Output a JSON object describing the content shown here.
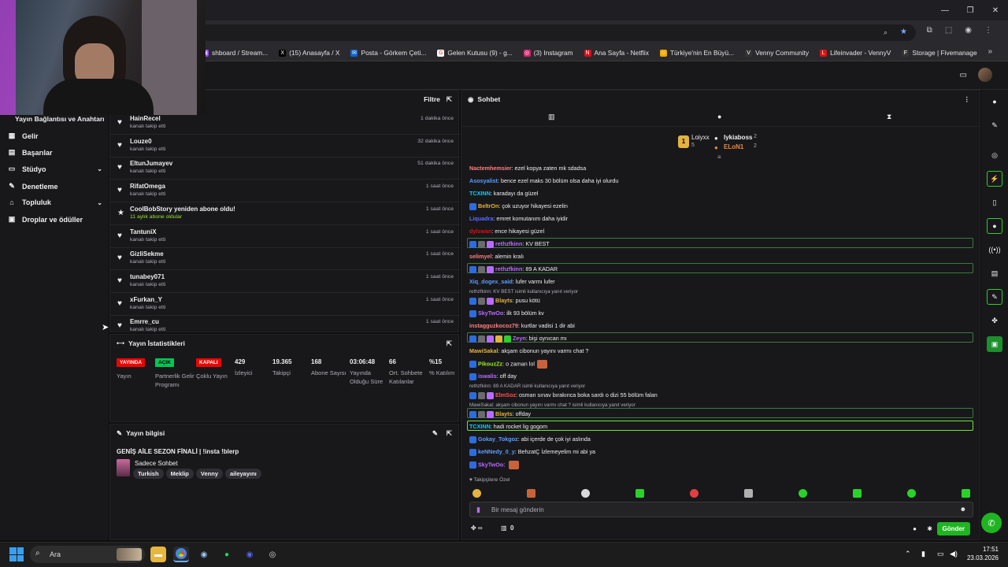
{
  "browser": {
    "bookmarks": [
      {
        "label": "shboard / Stream...",
        "color": "#9146ff",
        "glyph": "▣"
      },
      {
        "label": "(15) Anasayfa / X",
        "color": "#000000",
        "glyph": "X"
      },
      {
        "label": "Posta - Görkem Çeti...",
        "color": "#0a64d6",
        "glyph": "✉"
      },
      {
        "label": "Gelen Kutusu (9) - g...",
        "color": "#ffffff",
        "glyph": "G"
      },
      {
        "label": "(3) Instagram",
        "color": "#d6246e",
        "glyph": "◎"
      },
      {
        "label": "Ana Sayfa - Netflix",
        "color": "#e50914",
        "glyph": "N"
      },
      {
        "label": "Türkiye'nin En Büyü...",
        "color": "#f2a900",
        "glyph": "☺"
      },
      {
        "label": "Venny Community",
        "color": "#333333",
        "glyph": "V"
      },
      {
        "label": "Lifeinvader - VennyV",
        "color": "#d11",
        "glyph": "L"
      },
      {
        "label": "Storage | Fivemanage",
        "color": "#333333",
        "glyph": "F"
      }
    ]
  },
  "sidebar": {
    "section_title": "Yayın Bağlantısı ve Anahtarı",
    "items": [
      {
        "label": "Gelir",
        "icon": "revenue-icon",
        "glyph": "▦",
        "chevron": false
      },
      {
        "label": "Başarılar",
        "icon": "trophy-icon",
        "glyph": "▤",
        "chevron": false
      },
      {
        "label": "Stüdyo",
        "icon": "studio-icon",
        "glyph": "▭",
        "chevron": true
      },
      {
        "label": "Denetleme",
        "icon": "wrench-icon",
        "glyph": "✎",
        "chevron": false
      },
      {
        "label": "Topluluk",
        "icon": "community-icon",
        "glyph": "⌂",
        "chevron": true
      },
      {
        "label": "Droplar ve ödüller",
        "icon": "gift-icon",
        "glyph": "▣",
        "chevron": false
      }
    ]
  },
  "activity": {
    "filter_label": "Filtre",
    "rows": [
      {
        "name": "HainRecel",
        "desc": "kanalı takip etti",
        "time": "1 dakika önce",
        "icon": "♥"
      },
      {
        "name": "Louze0",
        "desc": "kanalı takip etti",
        "time": "32 dakika önce",
        "icon": "♥"
      },
      {
        "name": "EltunJumayev",
        "desc": "kanalı takip etti",
        "time": "51 dakika önce",
        "icon": "♥"
      },
      {
        "name": "RifatOmega",
        "desc": "kanalı takip etti",
        "time": "1 saat önce",
        "icon": "♥"
      },
      {
        "name": "CoolBobStory yeniden abone oldu!",
        "desc": "11 aylık abone oldular",
        "time": "1 saat önce",
        "icon": "★"
      },
      {
        "name": "TantuniX",
        "desc": "kanalı takip etti",
        "time": "1 saat önce",
        "icon": "♥"
      },
      {
        "name": "GizliSekme",
        "desc": "kanalı takip etti",
        "time": "1 saat önce",
        "icon": "♥"
      },
      {
        "name": "tunabey071",
        "desc": "kanalı takip etti",
        "time": "1 saat önce",
        "icon": "♥"
      },
      {
        "name": "xFurkan_Y",
        "desc": "kanalı takip etti",
        "time": "1 saat önce",
        "icon": "♥"
      },
      {
        "name": "Emrre_cu",
        "desc": "kanalı takip etti",
        "time": "1 saat önce",
        "icon": "♥"
      }
    ]
  },
  "stats": {
    "title": "Yayın İstatistikleri",
    "badges": [
      {
        "badge": "YAYINDA",
        "color": "#eb0400",
        "label": "Yayın"
      },
      {
        "badge": "AÇIK",
        "color": "#00c853",
        "label": "Partnerlik Gelir Programı"
      },
      {
        "badge": "KAPALI",
        "color": "#eb0400",
        "label": "Çoklu Yayın"
      }
    ],
    "numbers": [
      {
        "value": "429",
        "label": "İzleyici"
      },
      {
        "value": "19.365",
        "label": "Takipçi"
      },
      {
        "value": "168",
        "label": "Abone Sayısı"
      },
      {
        "value": "03:06:48",
        "label": "Yayında Olduğu Süre"
      },
      {
        "value": "66",
        "label": "Ort. Sohbete Katılanlar"
      },
      {
        "value": "%15",
        "label": "% Katılım"
      }
    ]
  },
  "info": {
    "title": "Yayın bilgisi",
    "stream_title": "GENİŞ AİLE SEZON FİNALİ | !insta !blerp",
    "category": "Sadece Sohbet",
    "tags": [
      "Turkish",
      "Meklip",
      "Venny",
      "aileyayını"
    ]
  },
  "chat": {
    "title": "Sohbet",
    "leaders": {
      "first": {
        "name": "Loiyxx",
        "count": "5"
      },
      "second": {
        "name": "lykiaboss",
        "count": "2"
      },
      "third": {
        "name": "ELoN1",
        "count": "2"
      }
    },
    "messages": [
      {
        "user": "Nactemhemsier",
        "color": "#ff7f7f",
        "text": "ezel kopya zaten mk sdadsa",
        "badges": 0,
        "hl": false
      },
      {
        "user": "Asosyalist",
        "color": "#5c9dff",
        "text": "bence ezel maks 30 bölüm olsa daha iyi olurdu",
        "badges": 0,
        "hl": false
      },
      {
        "user": "TCXINN",
        "color": "#00d2ff",
        "text": "karadayı da güzel",
        "badges": 0,
        "hl": false
      },
      {
        "user": "BeltrOn",
        "color": "#e3b341",
        "text": "çok uzuyor hikayesi ezelin",
        "badges": 1,
        "hl": false
      },
      {
        "user": "Liquadra",
        "color": "#5c6cff",
        "text": "emret komutanım daha iyidir",
        "badges": 0,
        "hl": false
      },
      {
        "user": "dylswan",
        "color": "#d11",
        "text": "ence hikayesi güzel",
        "badges": 0,
        "hl": false
      },
      {
        "user": "rethzfkinn",
        "color": "#b86cff",
        "text": "KV BEST",
        "badges": 3,
        "hl": true
      },
      {
        "user": "selimyel",
        "color": "#ff7f7f",
        "text": "alemin kralı",
        "badges": 0,
        "hl": false
      },
      {
        "user": "rethzfkinn",
        "color": "#b86cff",
        "text": "89 A KADAR",
        "badges": 3,
        "hl": true
      },
      {
        "user": "Xiq_dogex_said",
        "color": "#5c9dff",
        "text": "lufer varmı lufer",
        "badges": 0,
        "hl": false
      },
      {
        "user": "Blayts",
        "color": "#e3b341",
        "text": "pusu kötü",
        "badges": 3,
        "hl": false,
        "reply": "rethzfkinn: KV BEST isimli kullanıcıya yanıt veriyor"
      },
      {
        "user": "SkyTwOo",
        "color": "#b86cff",
        "text": "ilk 93 bölüm kv",
        "badges": 1,
        "hl": false
      },
      {
        "user": "instagguzkocoz79",
        "color": "#ff7f7f",
        "text": "kurtlar vadisi 1 dir abi",
        "badges": 0,
        "hl": false
      },
      {
        "user": "Zeyn",
        "color": "#b86cff",
        "text": "bişi oynıcan mı",
        "badges": 5,
        "hl": true
      },
      {
        "user": "MawiSakal",
        "color": "#e3b341",
        "text": "akşam cibonun yayını varmı chat ?",
        "badges": 0,
        "hl": false
      },
      {
        "user": "PikouzZz",
        "color": "#9be52d",
        "text": "o zaman lol",
        "badges": 1,
        "hl": false
      },
      {
        "user": "iswalis",
        "color": "#b86cff",
        "text": "off day",
        "badges": 1,
        "hl": false
      },
      {
        "user": "ElmSoz",
        "color": "#ff5050",
        "text": "osman sınav bırakınca boka sardı o dizi 55 bölüm falan",
        "badges": 3,
        "hl": false,
        "reply": "rethzfkinn: 89 A KADAR isimli kullanıcıya yanıt veriyor"
      },
      {
        "user": "Blayts",
        "color": "#e3b341",
        "text": "offday",
        "badges": 3,
        "hl": true,
        "reply": "MawiSakal: akşam cibonun yayını varmı chat ? isimli kullanıcıya yanıt veriyor"
      },
      {
        "user": "TCXINN",
        "color": "#00d2ff",
        "text": "hadi rocket lig gogom",
        "badges": 0,
        "hl": true
      },
      {
        "user": "Gokay_Tokgoz",
        "color": "#5c9dff",
        "text": "abi içerde de çok iyi aslında",
        "badges": 1,
        "hl": false
      },
      {
        "user": "keNNedy_0_y",
        "color": "#5c9dff",
        "text": "BehzatÇ İzlemeyelim mi abi ya",
        "badges": 1,
        "hl": false
      },
      {
        "user": "SkyTwOo",
        "color": "#b86cff",
        "text": "",
        "badges": 1,
        "hl": false
      }
    ],
    "emote_bar_label": "Takipçilere Özel",
    "input_placeholder": "Bir mesaj gönderin",
    "points": "0",
    "send_label": "Gönder"
  },
  "taskbar": {
    "search_placeholder": "Ara",
    "time": "17:51",
    "date": "23.03.2026"
  }
}
